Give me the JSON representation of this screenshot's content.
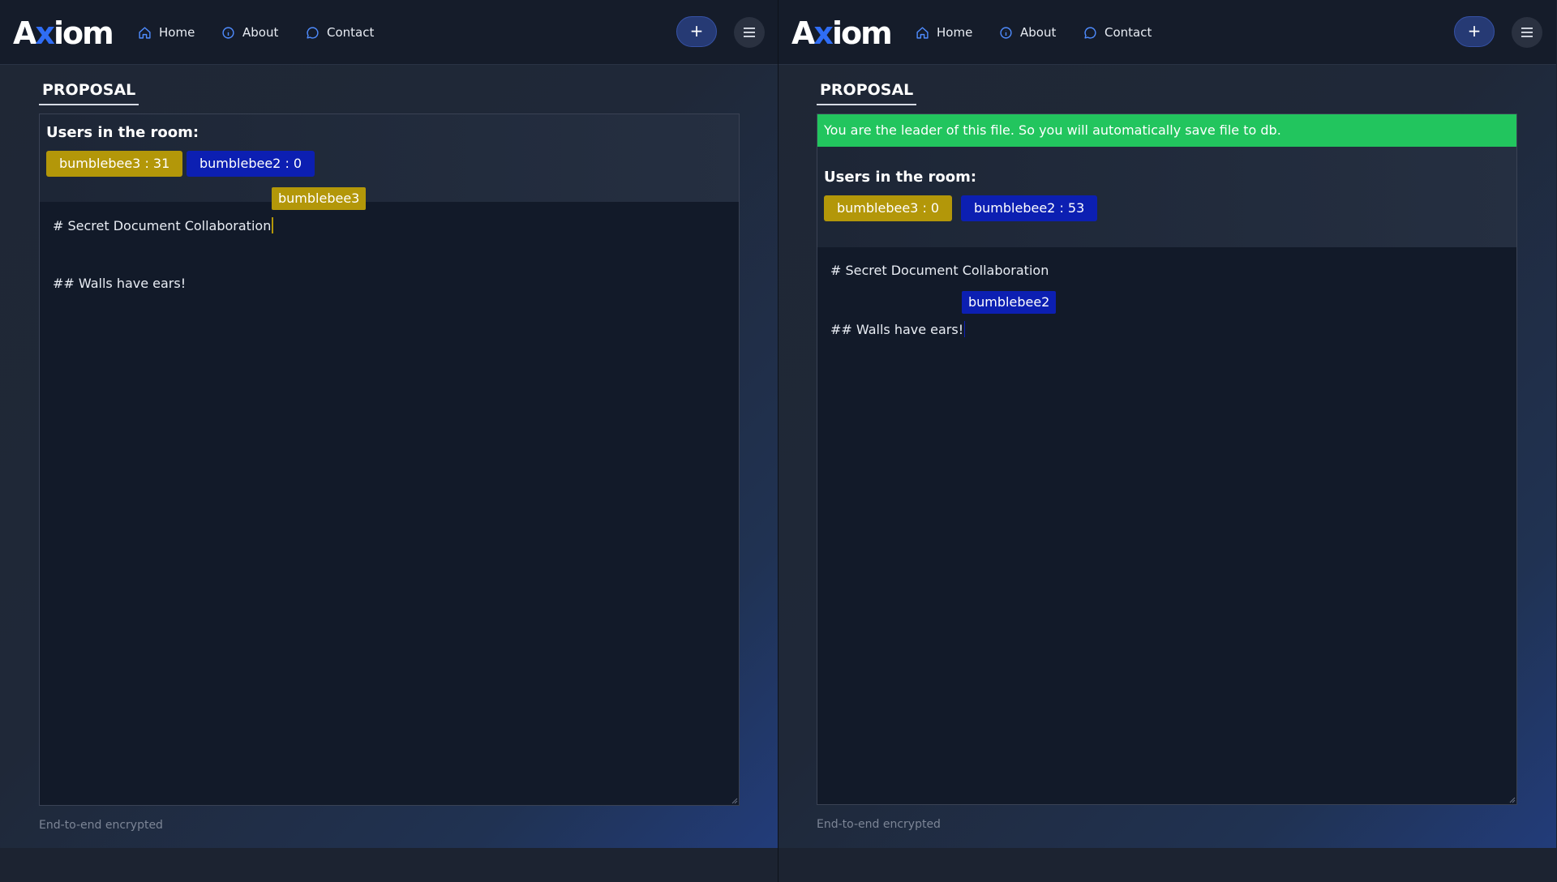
{
  "nav": {
    "logo_prefix": "A",
    "logo_accent": "x",
    "logo_suffix": "iom",
    "items": [
      "Home",
      "About",
      "Contact"
    ],
    "icons": [
      "home-icon",
      "info-icon",
      "chat-icon"
    ],
    "add_label": "+",
    "menu_icon": "hamburger-icon"
  },
  "colors": {
    "accent": "#2f6df5",
    "user_yellow": "#b39709",
    "user_blue": "#0c1fb2",
    "leader_green": "#22c55e"
  },
  "left": {
    "tab": "PROPOSAL",
    "users_title": "Users in the room:",
    "users": [
      {
        "label": "bumblebee3 : 31",
        "color": "yellow"
      },
      {
        "label": "bumblebee2 : 0",
        "color": "blue"
      }
    ],
    "cursor_label": "bumblebee3",
    "lines": [
      "# Secret Document Collaboration",
      "## Walls have ears!"
    ],
    "footer": "End-to-end encrypted"
  },
  "right": {
    "tab": "PROPOSAL",
    "leader_message": "You are the leader of this file. So you will automatically save file to db.",
    "users_title": "Users in the room:",
    "users": [
      {
        "label": "bumblebee3 : 0",
        "color": "yellow"
      },
      {
        "label": "bumblebee2 : 53",
        "color": "blue"
      }
    ],
    "cursor_label": "bumblebee2",
    "lines": [
      "# Secret Document Collaboration",
      "## Walls have ears!"
    ],
    "footer": "End-to-end encrypted"
  }
}
